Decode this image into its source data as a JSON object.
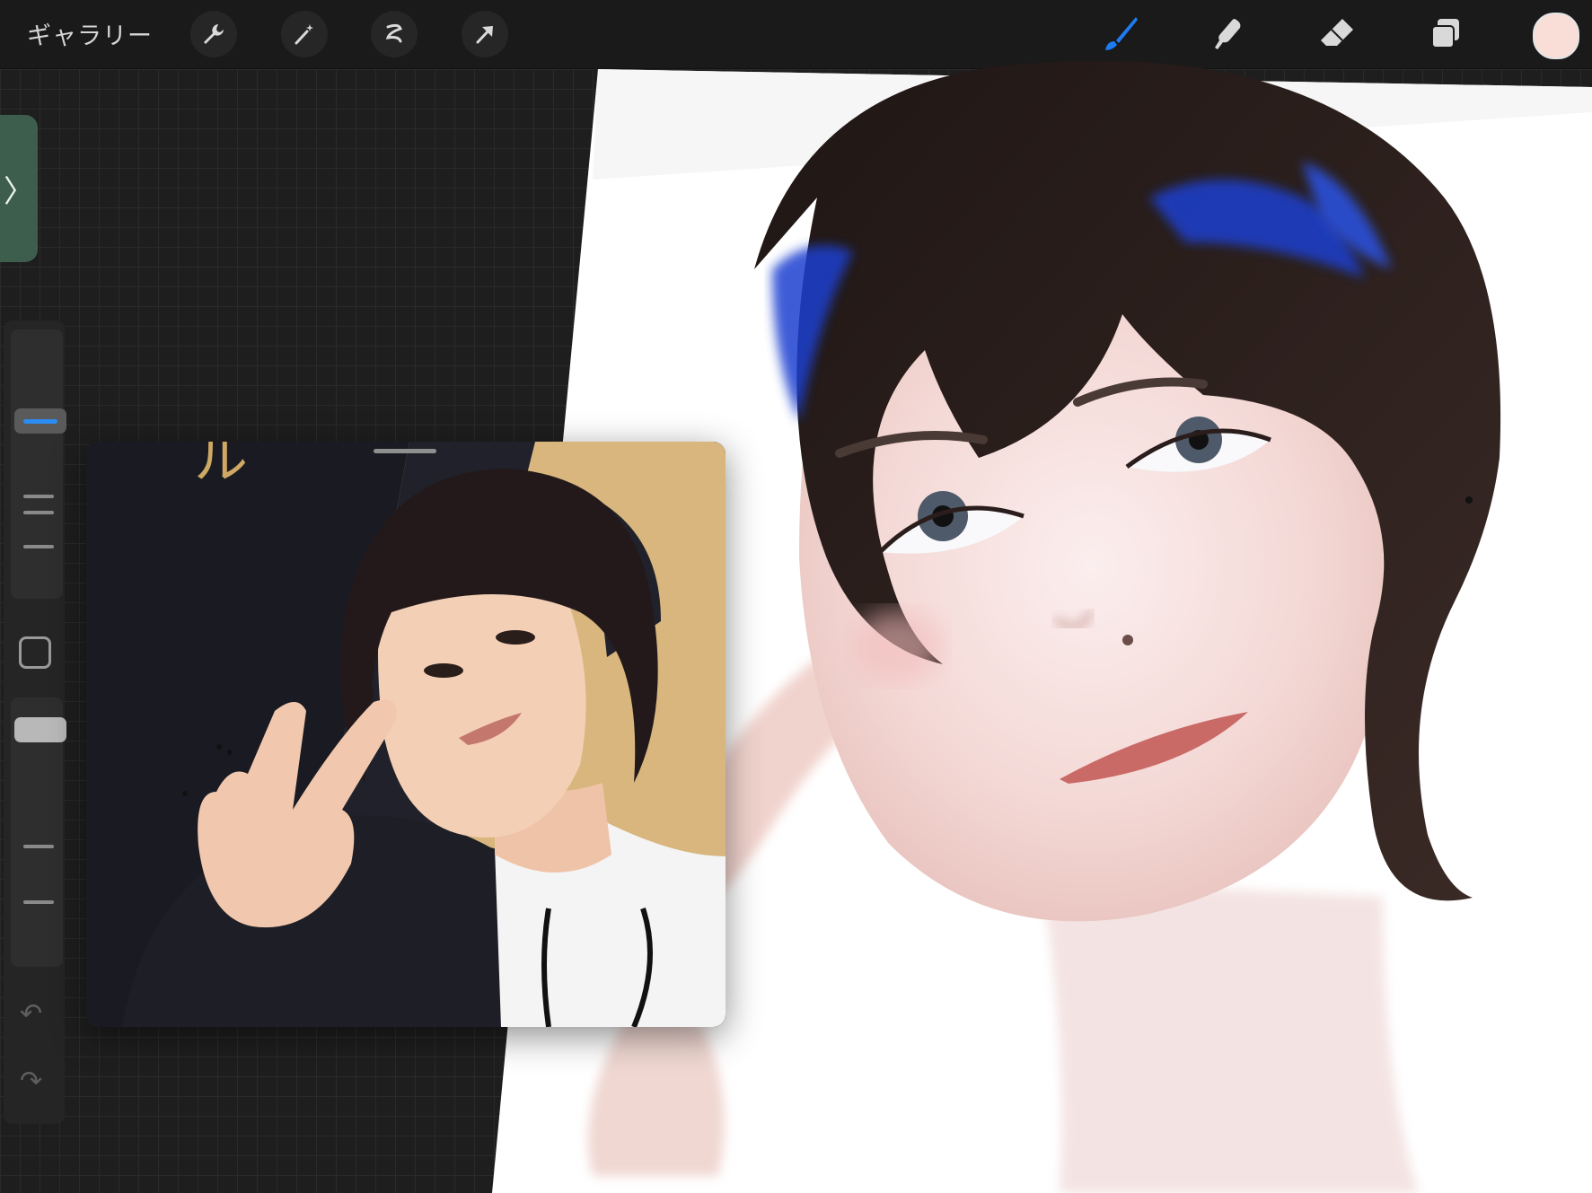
{
  "toolbar": {
    "gallery_label": "ギャラリー",
    "left_tools": [
      "wrench-icon",
      "magic-wand-icon",
      "selection-icon",
      "transform-arrow-icon"
    ],
    "right_tools": [
      "brush-icon",
      "smudge-icon",
      "eraser-icon",
      "layers-icon"
    ],
    "active_tool": "brush-icon",
    "accent_color": "#1d7cf2",
    "current_color": "#f8ded6"
  },
  "sidebar": {
    "expand_tab": "〉",
    "undo_icon": "↶",
    "redo_icon": "↷"
  },
  "reference": {
    "title": ""
  }
}
